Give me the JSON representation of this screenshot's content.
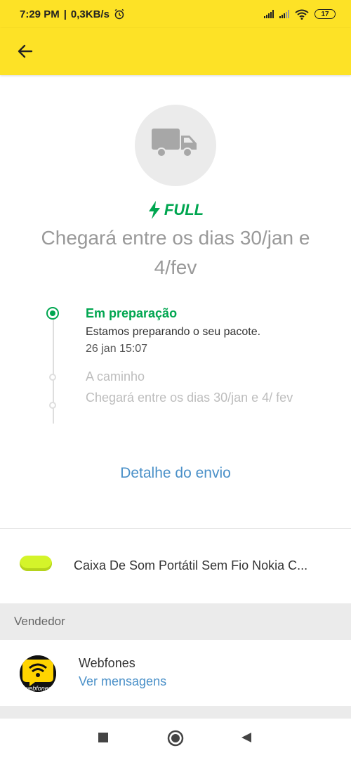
{
  "status_bar": {
    "time": "7:29 PM",
    "speed": "0,3KB/s",
    "battery": "17"
  },
  "app_bar": {
    "back_icon": "arrow-left-icon"
  },
  "shipment": {
    "icon": "truck-icon",
    "badge": "FULL",
    "eta": "Chegará entre os dias 30/jan e 4/fev"
  },
  "timeline": {
    "steps": [
      {
        "title": "Em preparação",
        "description": "Estamos preparando o seu pacote.",
        "date": "26 jan 15:07",
        "active": true
      },
      {
        "title": "A caminho",
        "description": "Chegará entre os dias 30/jan e 4/ fev",
        "active": false
      }
    ]
  },
  "detail_link": "Detalhe do envio",
  "product": {
    "title": "Caixa De Som Portátil Sem Fio Nokia C..."
  },
  "seller_section": {
    "header": "Vendedor",
    "name": "Webfones",
    "link": "Ver mensagens",
    "avatar_text": "webfones"
  },
  "colors": {
    "brand_yellow": "#fde226",
    "success_green": "#00a650",
    "link_blue": "#4a90c8"
  }
}
